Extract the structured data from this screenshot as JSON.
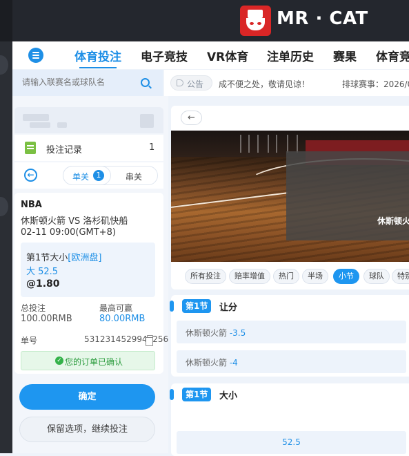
{
  "brand": {
    "name": "MR · CAT"
  },
  "nav": {
    "tabs": [
      {
        "label": "体育投注",
        "active": true
      },
      {
        "label": "电子竞技"
      },
      {
        "label": "VR体育"
      },
      {
        "label": "注单历史"
      },
      {
        "label": "赛果"
      },
      {
        "label": "体育竞"
      }
    ]
  },
  "search": {
    "placeholder": "请输入联赛名或球队名"
  },
  "notice": {
    "pill_label": "公告",
    "text": "成不便之处，敬请见谅！",
    "text2": "排球赛事：2026/0"
  },
  "betslip": {
    "record_label": "投注记录",
    "record_count": "1",
    "mode_single": "单关",
    "single_count": "1",
    "mode_multi": "串关",
    "league": "NBA",
    "match": "休斯顿火箭 VS 洛杉矶快船",
    "time": "02-11 09:00(GMT+8)",
    "market": "第1节大小",
    "market_type": "[欧洲盘]",
    "selection": "大 52.5",
    "odds": "@1.80",
    "total_label": "总投注",
    "total_value": "100.00RMB",
    "max_win_label": "最高可赢",
    "max_win_value": "80.00RMB",
    "order_label": "单号",
    "order_no": "5312314529943256",
    "confirmed_text": "您的订单已确认",
    "confirm_button": "确定",
    "keep_button": "保留选项，继续投注"
  },
  "video": {
    "overlay_team": "休斯顿火"
  },
  "filters": [
    "所有投注",
    "赔率增值",
    "热门",
    "半场",
    "小节",
    "球队",
    "特别"
  ],
  "active_filter": "小节",
  "sections": {
    "handicap": {
      "tag": "第1节",
      "title": "让分",
      "rows": [
        {
          "team": "休斯顿火箭",
          "line": "-3.5"
        },
        {
          "team": "休斯顿火箭",
          "line": "-4"
        }
      ]
    },
    "totals": {
      "tag": "第1节",
      "title": "大小",
      "rows": [
        {
          "line": "52.5"
        }
      ]
    }
  },
  "colors": {
    "accent": "#1e96f0",
    "brand_red": "#d92626",
    "success": "#34b24a"
  }
}
